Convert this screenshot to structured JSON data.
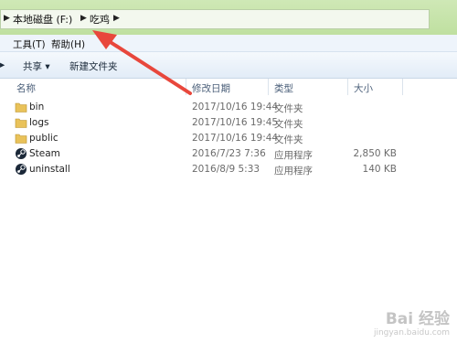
{
  "address_bar": {
    "crumbs": [
      "本地磁盘 (F:)",
      "吃鸡"
    ]
  },
  "menu": [
    "工具(T)",
    "帮助(H)"
  ],
  "toolbar": {
    "share_label": "共享 ▾",
    "new_folder_label": "新建文件夹"
  },
  "columns": {
    "name": "名称",
    "modified": "修改日期",
    "type": "类型",
    "size": "大小"
  },
  "files": [
    {
      "name": "bin",
      "modified": "2017/10/16 19:44",
      "type": "文件夹",
      "size": "",
      "icon": "folder-icon"
    },
    {
      "name": "logs",
      "modified": "2017/10/16 19:45",
      "type": "文件夹",
      "size": "",
      "icon": "folder-icon"
    },
    {
      "name": "public",
      "modified": "2017/10/16 19:44",
      "type": "文件夹",
      "size": "",
      "icon": "folder-icon"
    },
    {
      "name": "Steam",
      "modified": "2016/7/23 7:36",
      "type": "应用程序",
      "size": "2,850 KB",
      "icon": "steam-icon"
    },
    {
      "name": "uninstall",
      "modified": "2016/8/9 5:33",
      "type": "应用程序",
      "size": "140 KB",
      "icon": "steam-icon"
    }
  ],
  "watermark": {
    "logo": "Bai 经验",
    "url": "jingyan.baidu.com"
  },
  "colors": {
    "arrow": "#e8473c",
    "folder": "#e9c25a",
    "address_bar": "#c6e4a9"
  }
}
